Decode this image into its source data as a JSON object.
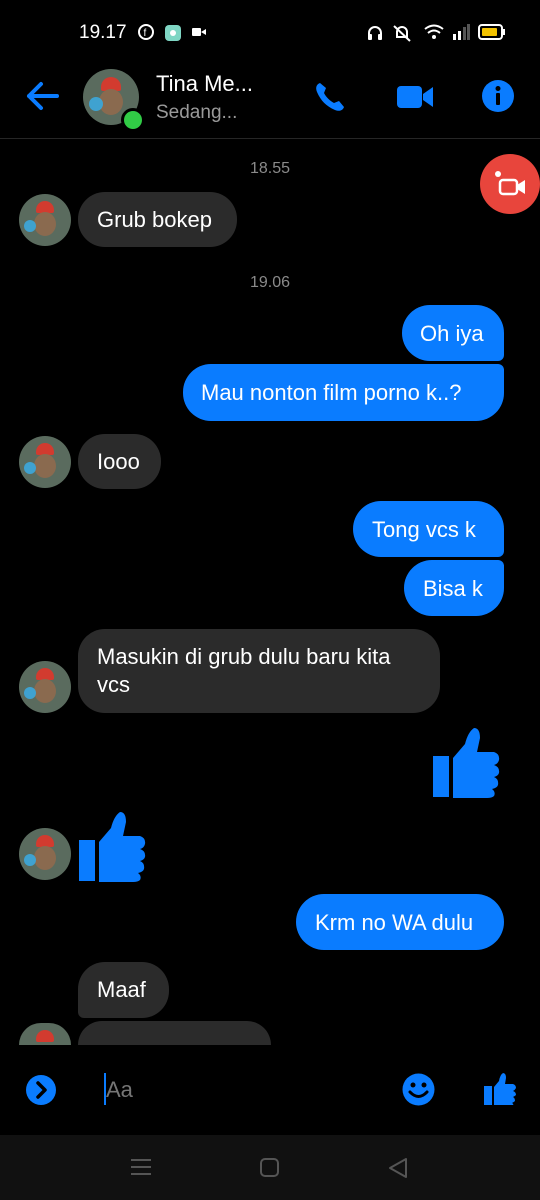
{
  "status": {
    "time": "19.17"
  },
  "header": {
    "name": "Tina Me...",
    "subtitle": "Sedang..."
  },
  "colors": {
    "accent": "#0a7cff",
    "incoming": "#2b2b2b",
    "video_fab": "#e8453c"
  },
  "conversation": {
    "timestamps": [
      "18.55",
      "19.06"
    ],
    "messages": [
      {
        "text": "Grub bokep"
      },
      {
        "text": "Oh iya"
      },
      {
        "text": "Mau nonton film porno k..?"
      },
      {
        "text": "Iooo"
      },
      {
        "text": "Tong vcs k"
      },
      {
        "text": "Bisa k"
      },
      {
        "text": "Masukin di grub dulu baru kita vcs"
      },
      {
        "text": "Krm no WA dulu"
      },
      {
        "text": "Maaf"
      }
    ]
  },
  "composer": {
    "placeholder": "Aa"
  }
}
